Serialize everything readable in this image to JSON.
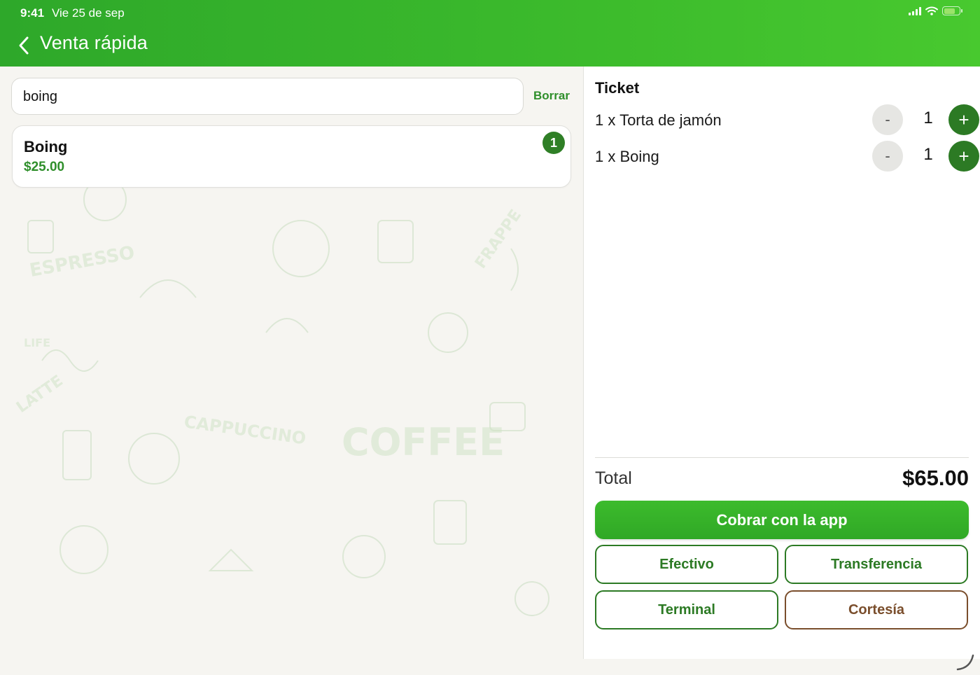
{
  "status_bar": {
    "time": "9:41",
    "date": "Vie 25 de sep",
    "icons": [
      "signal-icon",
      "wifi-icon",
      "battery-charging-icon"
    ]
  },
  "header": {
    "title": "Venta rápida",
    "back_icon": "chevron-left-icon"
  },
  "search": {
    "value": "boing",
    "clear_label": "Borrar"
  },
  "results": [
    {
      "name": "Boing",
      "price": "$25.00",
      "count": "1"
    }
  ],
  "background_art": {
    "words": [
      "ESPRESSO",
      "LATTE",
      "CAPPUCCINO",
      "COFFEE",
      "FRAPPE",
      "LIFE"
    ]
  },
  "ticket": {
    "title": "Ticket",
    "items": [
      {
        "text": "1 x Torta de jamón",
        "qty": "1",
        "minus": "-",
        "plus": "+"
      },
      {
        "text": "1 x Boing",
        "qty": "1",
        "minus": "-",
        "plus": "+"
      }
    ],
    "total_label": "Total",
    "total_value": "$65.00"
  },
  "actions": {
    "primary": "Cobrar con la app",
    "cash": "Efectivo",
    "transfer": "Transferencia",
    "terminal": "Terminal",
    "courtesy": "Cortesía"
  },
  "colors": {
    "brand_green": "#3cbb2c",
    "dark_green": "#2c7a24",
    "price_green": "#2f8f2b",
    "courtesy_brown": "#7a4e2c"
  }
}
